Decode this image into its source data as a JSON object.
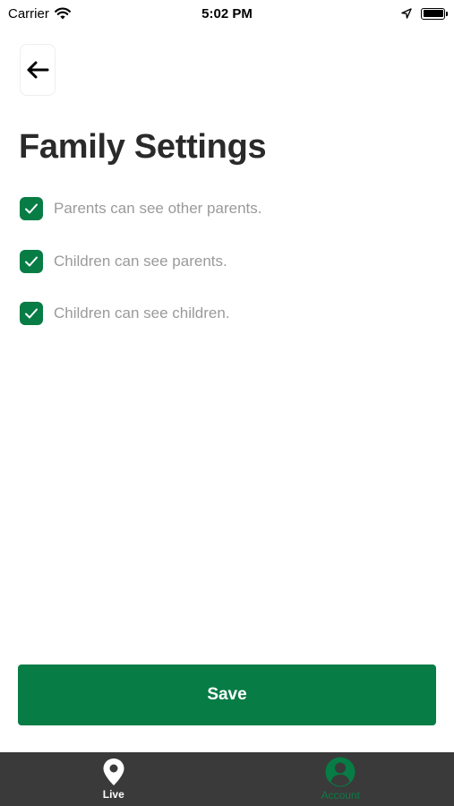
{
  "status_bar": {
    "carrier": "Carrier",
    "time": "5:02 PM"
  },
  "page": {
    "title": "Family Settings"
  },
  "settings": [
    {
      "label": "Parents can see other parents.",
      "checked": true
    },
    {
      "label": "Children can see parents.",
      "checked": true
    },
    {
      "label": "Children can see children.",
      "checked": true
    }
  ],
  "actions": {
    "save_label": "Save"
  },
  "tab_bar": {
    "tabs": [
      {
        "label": "Live",
        "icon": "map-pin-icon",
        "active": false
      },
      {
        "label": "Account",
        "icon": "user-circle-icon",
        "active": true
      }
    ]
  },
  "colors": {
    "accent": "#077c45",
    "tab_bar_bg": "#3a3a3a",
    "label_gray": "#9a9a9a"
  }
}
